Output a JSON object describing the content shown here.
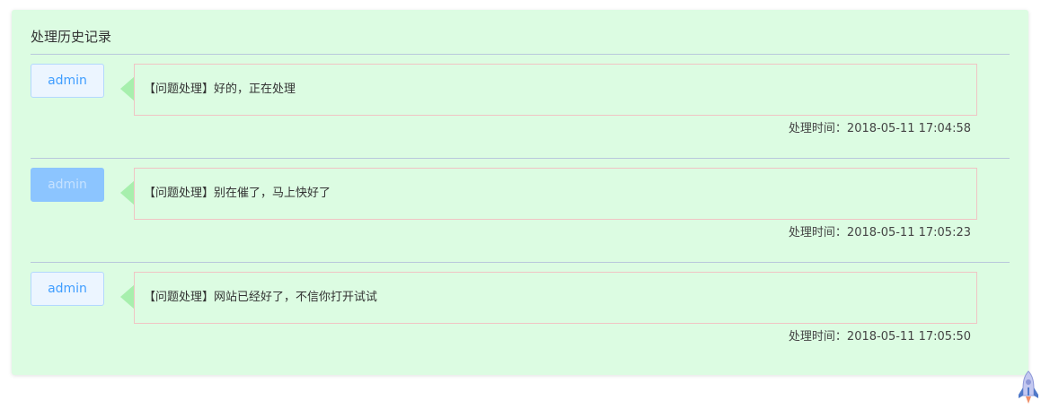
{
  "panel": {
    "title": "处理历史记录"
  },
  "records": [
    {
      "user": "admin",
      "message": "【问题处理】好的，正在处理",
      "time_label": "处理时间：",
      "time": "2018-05-11 17:04:58"
    },
    {
      "user": "admin",
      "message": "【问题处理】别在催了，马上快好了",
      "time_label": "处理时间：",
      "time": "2018-05-11 17:05:23"
    },
    {
      "user": "admin",
      "message": "【问题处理】网站已经好了，不信你打开试试",
      "time_label": "处理时间：",
      "time": "2018-05-11 17:05:50"
    }
  ],
  "back_to_top": {
    "icon": "rocket-icon"
  },
  "colors": {
    "panel_bg": "#dcfce2",
    "button_border": "#b3d8ff",
    "button_text": "#409eff",
    "button_hover_bg": "#8cc5ff",
    "arrow": "#a7efad",
    "bubble_border": "#f0c4c4"
  }
}
